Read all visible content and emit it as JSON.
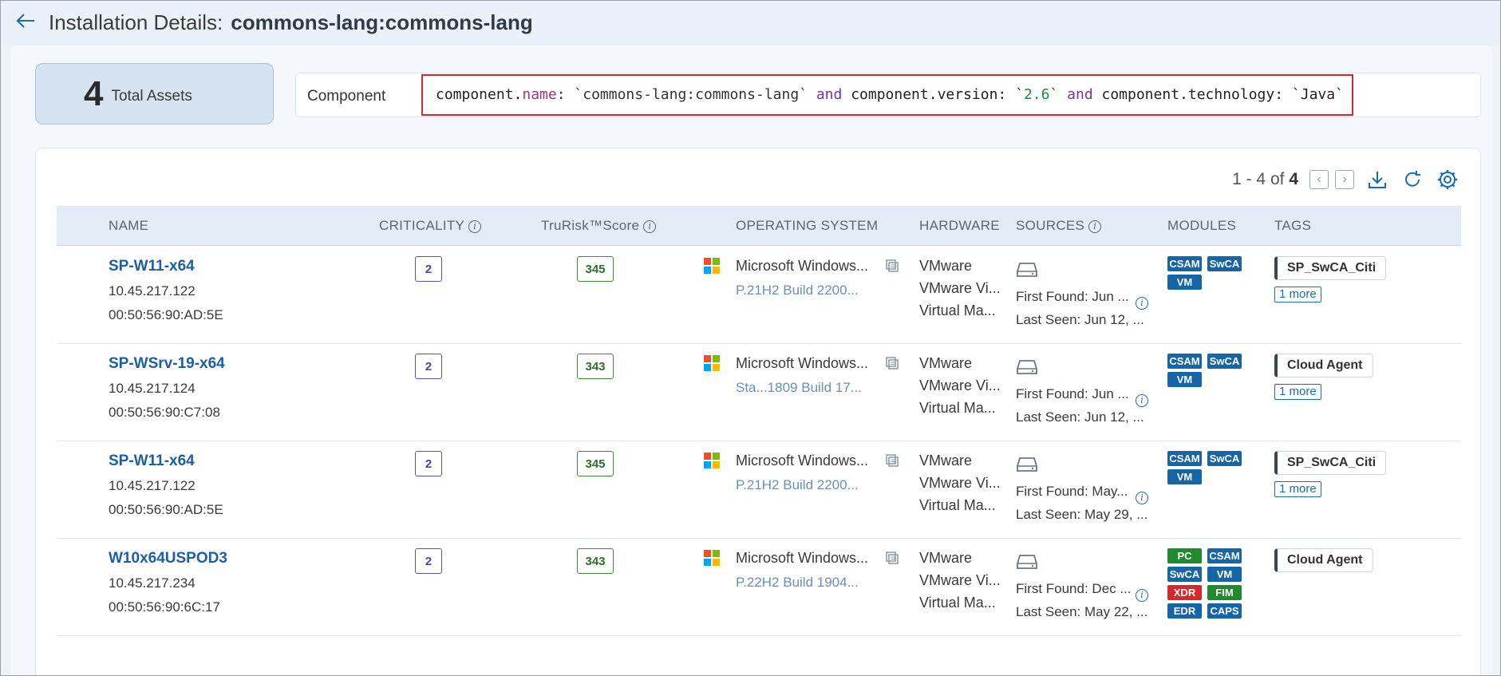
{
  "header": {
    "title": "Installation Details:",
    "title_name": "commons-lang:commons-lang"
  },
  "assets": {
    "count": "4",
    "label": "Total Assets"
  },
  "query": {
    "label": "Component",
    "p1": "component.",
    "p2": "name",
    "p3": ": `commons-lang:commons-lang` ",
    "p4": "and",
    "p5": " component.version: `",
    "p6": "2.6",
    "p7": "` ",
    "p8": "and",
    "p9": " component.technology: `Java`"
  },
  "pager": {
    "range": "1 - 4 of",
    "total": "4"
  },
  "columns": {
    "name": "NAME",
    "criticality": "CRITICALITY",
    "trurisk": "TruRisk™Score",
    "os": "OPERATING SYSTEM",
    "hardware": "HARDWARE",
    "sources": "SOURCES",
    "modules": "MODULES",
    "tags": "TAGS"
  },
  "rows": [
    {
      "name": "SP-W11-x64",
      "ip": "10.45.217.122",
      "mac": "00:50:56:90:AD:5E",
      "criticality": "2",
      "score": "345",
      "os_name": "Microsoft Windows...",
      "os_version": "P.21H2 Build 2200...",
      "hw1": "VMware",
      "hw2": "VMware Vi...",
      "hw3": "Virtual Ma...",
      "first_found": "First Found: Jun ...",
      "last_seen": "Last Seen: Jun 12, ...",
      "modules": [
        "CSAM",
        "SwCA",
        "VM"
      ],
      "tag": "SP_SwCA_Citi",
      "more": "1 more"
    },
    {
      "name": "SP-WSrv-19-x64",
      "ip": "10.45.217.124",
      "mac": "00:50:56:90:C7:08",
      "criticality": "2",
      "score": "343",
      "os_name": "Microsoft Windows...",
      "os_version": "Sta...1809 Build 17...",
      "hw1": "VMware",
      "hw2": "VMware Vi...",
      "hw3": "Virtual Ma...",
      "first_found": "First Found: Jun ...",
      "last_seen": "Last Seen: Jun 12, ...",
      "modules": [
        "CSAM",
        "SwCA",
        "VM"
      ],
      "tag": "Cloud Agent",
      "more": "1 more"
    },
    {
      "name": "SP-W11-x64",
      "ip": "10.45.217.122",
      "mac": "00:50:56:90:AD:5E",
      "criticality": "2",
      "score": "345",
      "os_name": "Microsoft Windows...",
      "os_version": "P.21H2 Build 2200...",
      "hw1": "VMware",
      "hw2": "VMware Vi...",
      "hw3": "Virtual Ma...",
      "first_found": "First Found: May...",
      "last_seen": "Last Seen: May 29, ...",
      "modules": [
        "CSAM",
        "SwCA",
        "VM"
      ],
      "tag": "SP_SwCA_Citi",
      "more": "1 more"
    },
    {
      "name": "W10x64USPOD3",
      "ip": "10.45.217.234",
      "mac": "00:50:56:90:6C:17",
      "criticality": "2",
      "score": "343",
      "os_name": "Microsoft Windows...",
      "os_version": "P.22H2 Build 1904...",
      "hw1": "VMware",
      "hw2": "VMware Vi...",
      "hw3": "Virtual Ma...",
      "first_found": "First Found: Dec ...",
      "last_seen": "Last Seen: May 22, ...",
      "modules": [
        "PC",
        "CSAM",
        "SwCA",
        "VM",
        "XDR",
        "FIM",
        "EDR",
        "CAPS"
      ],
      "tag": "Cloud Agent"
    }
  ],
  "icons": {
    "back": "arrow-left-icon",
    "prev": "chevron-left-icon",
    "next": "chevron-right-icon",
    "download": "download-icon",
    "refresh": "refresh-icon",
    "settings": "gear-icon",
    "os": "windows-logo-icon",
    "copy": "copy-icon",
    "source": "drive-icon",
    "info": "info-icon"
  },
  "colors": {
    "link": "#1a5fa8",
    "module_blue": "#1565a8",
    "module_green": "#1f8a2e",
    "module_red": "#d9272e",
    "query_border": "#d6282e",
    "score": "#3f8a3a",
    "criticality": "#5a56a6"
  }
}
